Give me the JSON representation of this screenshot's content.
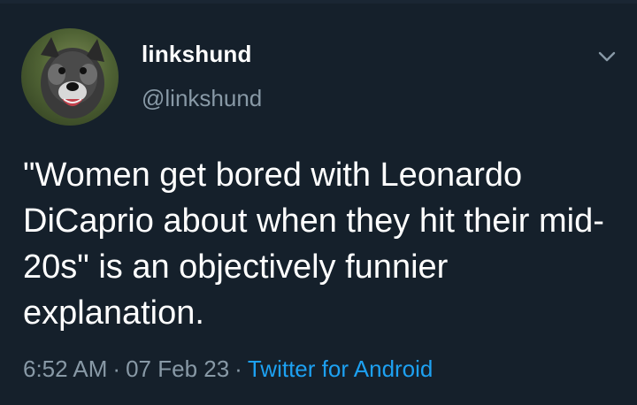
{
  "tweet": {
    "author": {
      "display_name": "linkshund",
      "handle": "@linkshund",
      "avatar_icon": "dog-avatar-icon"
    },
    "text": "\"Women get bored with Leonardo DiCaprio about when they hit their mid-20s\" is an objectively funnier explanation.",
    "time": "6:52 AM",
    "separator": "·",
    "date": "07 Feb 23",
    "source": "Twitter for Android",
    "menu_icon": "chevron-down-icon"
  },
  "colors": {
    "background": "#15202b",
    "text": "#ffffff",
    "muted": "#8899a6",
    "link": "#1da1f2"
  }
}
